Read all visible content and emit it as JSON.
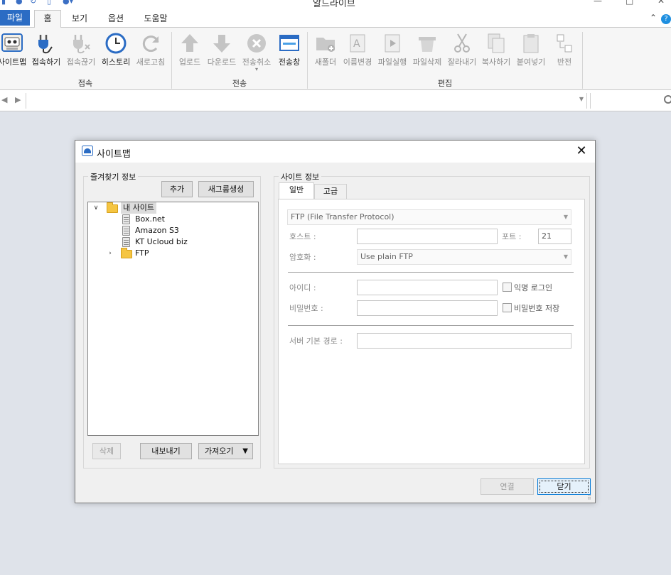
{
  "app": {
    "title": "알드라이브"
  },
  "ribbon_tabs": {
    "file": "파일",
    "home": "홈",
    "view": "보기",
    "options": "옵션",
    "help": "도움말"
  },
  "ribbon": {
    "connect_group": {
      "label": "접속",
      "sitemap": "사이트맵",
      "connect": "접속하기",
      "disconnect": "접속끊기",
      "history": "히스토리",
      "refresh": "새로고침"
    },
    "transfer_group": {
      "label": "전송",
      "upload": "업로드",
      "download": "다운로드",
      "cancel": "전송취소",
      "window": "전송창"
    },
    "edit_group": {
      "label": "편집",
      "new_folder": "새폴더",
      "rename": "이름변경",
      "run": "파일실행",
      "delete": "파일삭제",
      "cut": "잘라내기",
      "copy": "복사하기",
      "paste": "붙여넣기",
      "invert": "반전"
    }
  },
  "dialog": {
    "title": "사이트맵",
    "favorites": {
      "legend": "즐겨찾기 정보",
      "add_button": "추가",
      "new_group_button": "새그룹생성",
      "delete_button": "삭제",
      "export_button": "내보내기",
      "import_button": "가져오기",
      "tree": {
        "root": "내 사이트",
        "items": [
          "Box.net",
          "Amazon S3",
          "KT Ucloud biz"
        ],
        "folder": "FTP"
      }
    },
    "site_info": {
      "legend": "사이트 정보",
      "tabs": [
        "일반",
        "고급"
      ],
      "protocol": "FTP (File Transfer Protocol)",
      "host_label": "호스트 :",
      "host_value": "",
      "port_label": "포트 :",
      "port_value": "21",
      "encryption_label": "암호화 :",
      "encryption_value": "Use plain FTP",
      "id_label": "아이디 :",
      "anonymous_label": "익명 로그인",
      "password_label": "비밀번호 :",
      "save_password_label": "비밀번호 저장",
      "path_label": "서버 기본 경로 :"
    },
    "connect_button": "연결",
    "close_button": "닫기"
  }
}
